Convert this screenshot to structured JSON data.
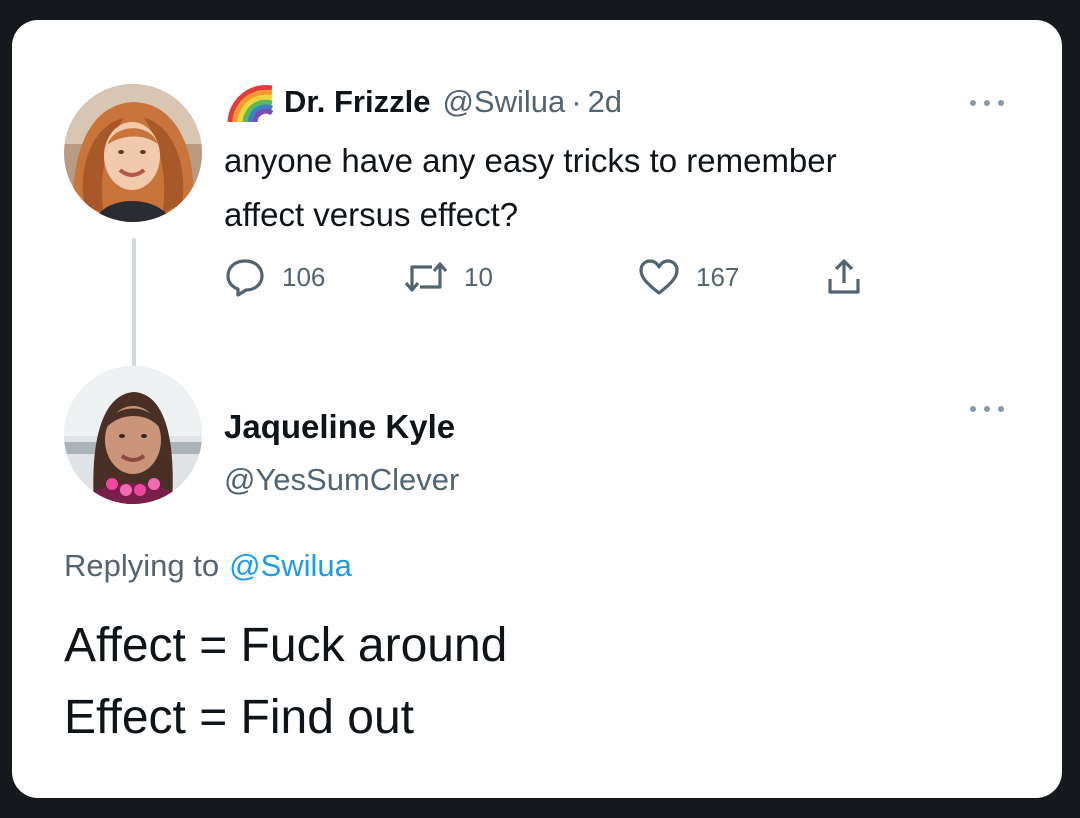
{
  "original_tweet": {
    "display_name": "Dr. Frizzle",
    "name_emoji": "rainbow-emoji",
    "handle": "@Swilua",
    "separator": "·",
    "time": "2d",
    "text_lines": [
      "anyone have any easy tricks to remember",
      "affect versus effect?"
    ],
    "actions": {
      "replies": "106",
      "retweets": "10",
      "likes": "167"
    }
  },
  "reply_tweet": {
    "display_name": "Jaqueline Kyle",
    "handle": "@YesSumClever",
    "replying_prefix": "Replying to",
    "replying_to": "@Swilua",
    "text_lines": [
      "Affect = Fuck around",
      "Effect = Find out"
    ]
  },
  "colors": {
    "background": "#15181c",
    "card": "#ffffff",
    "text_primary": "#0f1419",
    "text_secondary": "#536471",
    "link": "#1d9bf0"
  },
  "icons": [
    "rainbow-emoji",
    "more-icon",
    "reply-icon",
    "retweet-icon",
    "like-icon",
    "share-icon"
  ]
}
